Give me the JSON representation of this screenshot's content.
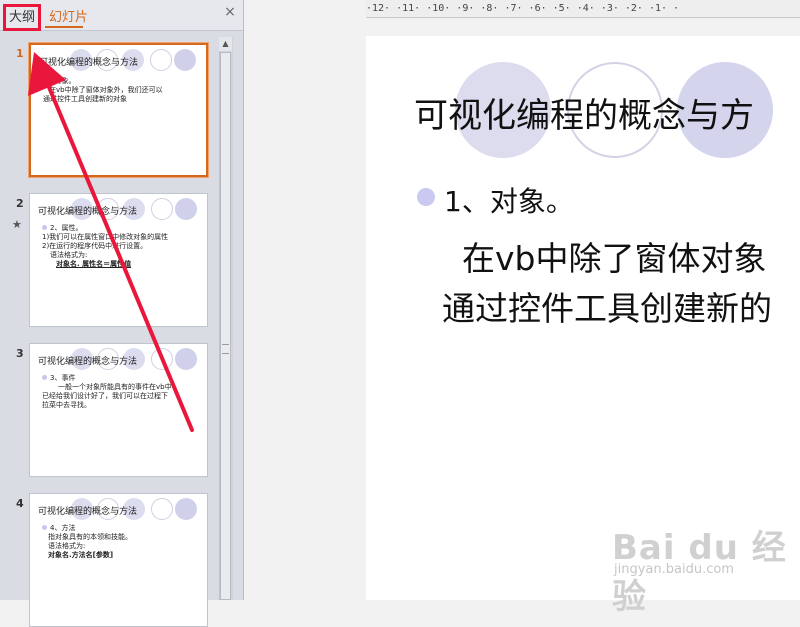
{
  "tabs": {
    "outline": "大纲",
    "slides": "幻灯片"
  },
  "close_glyph": "×",
  "ruler": "·12·  ·11·  ·10·  ·9·  ·8·  ·7·  ·6·  ·5·  ·4·  ·3·  ·2·  ·1·  ·",
  "slides": [
    {
      "number": "1",
      "title": "可视化编程的概念与方法",
      "lines": [
        "1、对象。",
        "在vb中除了窗体对象外，我们还可以",
        "通过控件工具创建新的对象"
      ]
    },
    {
      "number": "2",
      "title": "可视化编程的概念与方法",
      "lines": [
        "2、属性。",
        "1)我们可以在属性窗口中修改对象的属性",
        "2)在运行的程序代码中进行设置。",
        "语法格式为:"
      ],
      "bold": "对象名. 属性名＝属性值"
    },
    {
      "number": "3",
      "title": "可视化编程的概念与方法",
      "lines": [
        "3、事件",
        "一般一个对象所能具有的事件在vb中",
        "已经给我们设计好了，我们可以在过程下",
        "拉菜中去寻找。"
      ]
    },
    {
      "number": "4",
      "title": "可视化编程的概念与方法",
      "lines": [
        "4、方法",
        "指对象具有的本领和技能。",
        "语法格式为:"
      ],
      "bold": "对象名.方法名[参数]"
    }
  ],
  "main_slide": {
    "title": "可视化编程的概念与方",
    "item": "1、对象。",
    "line1": "在vb中除了窗体对象",
    "line2": "通过控件工具创建新的"
  },
  "watermark": {
    "logo": "Bai du 经验",
    "url": "jingyan.baidu.com"
  },
  "annotation_color": "#e8173b",
  "accent_color": "#d2691e"
}
